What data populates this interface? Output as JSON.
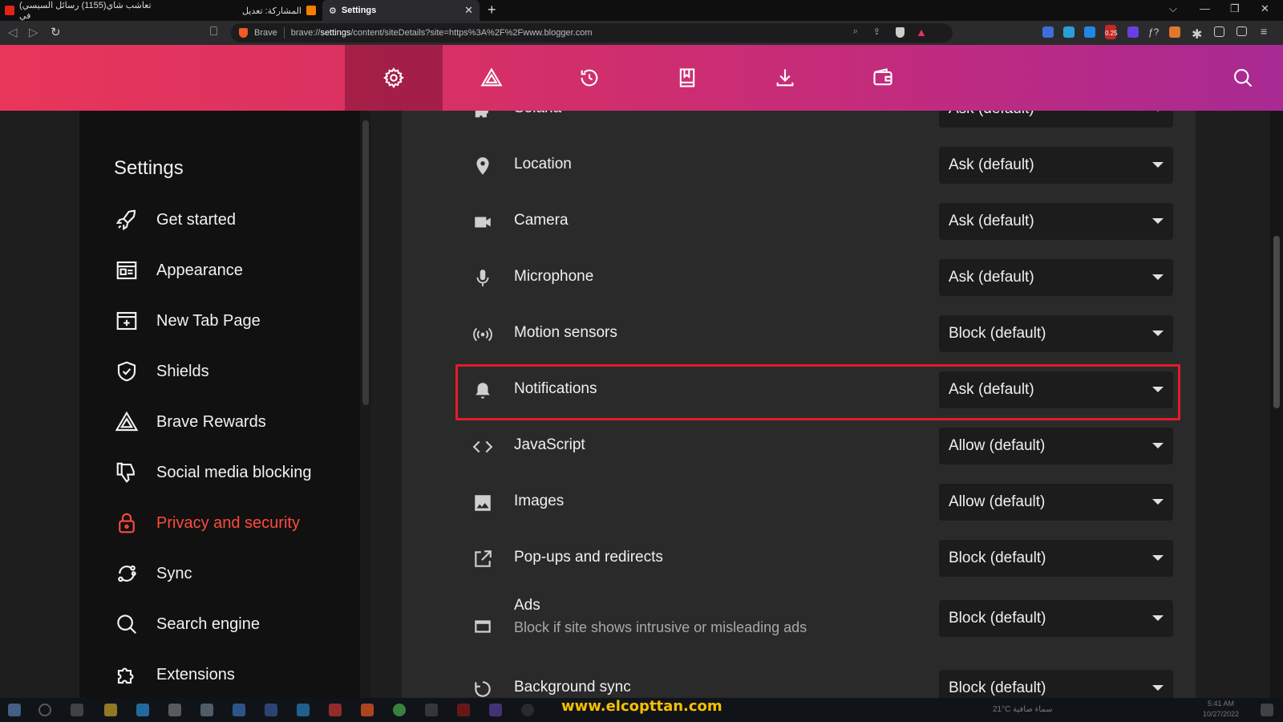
{
  "browser": {
    "tabs": [
      {
        "label": "(تعاشب شاي(1155) رسائل السيسي في",
        "favicon": "youtube-icon"
      },
      {
        "label": "المشاركة: تعديل",
        "favicon": "blogger-icon"
      },
      {
        "label": "Settings",
        "favicon": "gear-icon"
      }
    ],
    "shield_label": "Brave",
    "url_prefix": "brave://",
    "url_host": "settings",
    "url_rest": "/content/siteDetails?site=https%3A%2F%2Fwww.blogger.com",
    "ext_badge": "0.25"
  },
  "nav": {
    "items": [
      {
        "name": "settings-gear-icon",
        "active": true
      },
      {
        "name": "rewards-triangle-icon",
        "active": false
      },
      {
        "name": "history-icon",
        "active": false
      },
      {
        "name": "bookmarks-icon",
        "active": false
      },
      {
        "name": "downloads-icon",
        "active": false
      },
      {
        "name": "wallet-icon",
        "active": false
      }
    ]
  },
  "sidebar": {
    "title": "Settings",
    "items": [
      {
        "label": "Get started",
        "icon": "rocket-icon"
      },
      {
        "label": "Appearance",
        "icon": "appearance-icon"
      },
      {
        "label": "New Tab Page",
        "icon": "new-tab-icon"
      },
      {
        "label": "Shields",
        "icon": "shield-icon"
      },
      {
        "label": "Brave Rewards",
        "icon": "rewards-icon"
      },
      {
        "label": "Social media blocking",
        "icon": "thumbs-down-icon"
      },
      {
        "label": "Privacy and security",
        "icon": "lock-icon",
        "active": true
      },
      {
        "label": "Sync",
        "icon": "sync-icon"
      },
      {
        "label": "Search engine",
        "icon": "search-icon"
      },
      {
        "label": "Extensions",
        "icon": "puzzle-icon"
      }
    ]
  },
  "permissions": [
    {
      "label": "Solana",
      "value": "Ask (default)",
      "icon": "puzzle-icon"
    },
    {
      "label": "Location",
      "value": "Ask (default)",
      "icon": "location-pin-icon"
    },
    {
      "label": "Camera",
      "value": "Ask (default)",
      "icon": "camera-icon"
    },
    {
      "label": "Microphone",
      "value": "Ask (default)",
      "icon": "microphone-icon"
    },
    {
      "label": "Motion sensors",
      "value": "Block (default)",
      "icon": "sensors-icon"
    },
    {
      "label": "Notifications",
      "value": "Ask (default)",
      "icon": "bell-icon",
      "highlighted": true
    },
    {
      "label": "JavaScript",
      "value": "Allow (default)",
      "icon": "code-icon"
    },
    {
      "label": "Images",
      "value": "Allow (default)",
      "icon": "image-icon"
    },
    {
      "label": "Pop-ups and redirects",
      "value": "Block (default)",
      "icon": "open-external-icon"
    },
    {
      "label": "Ads",
      "sublabel": "Block if site shows intrusive or misleading ads",
      "value": "Block (default)",
      "icon": "ads-window-icon"
    },
    {
      "label": "Background sync",
      "value": "Block (default)",
      "icon": "background-sync-icon"
    }
  ],
  "taskbar": {
    "watermark": "www.elcopttan.com",
    "weather": "21°C  سماء صافية",
    "time": "5:41 AM",
    "date": "10/27/2022"
  },
  "colors": {
    "accent_active": "#ff4a3d",
    "highlight_border": "#e21b2c",
    "header_gradient_start": "#e8365a",
    "header_gradient_end": "#a82a93"
  }
}
